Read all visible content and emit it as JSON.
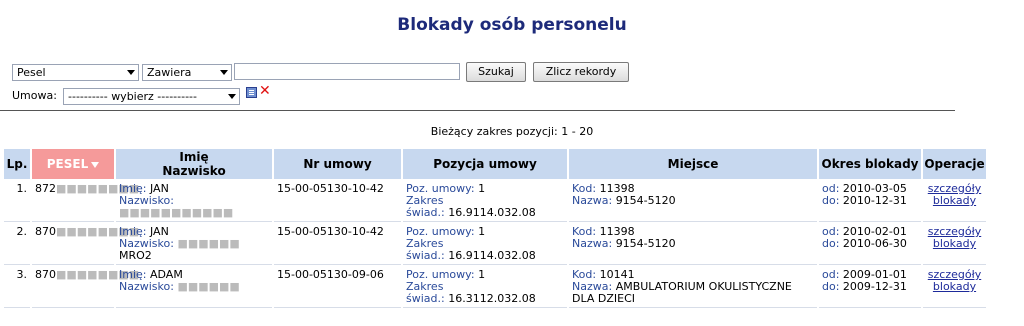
{
  "page": {
    "title": "Blokady osób personelu"
  },
  "search": {
    "field_select": "Pesel",
    "mode_select": "Zawiera",
    "query": "",
    "search_button": "Szukaj",
    "count_button": "Zlicz rekordy"
  },
  "filter": {
    "umowa_label": "Umowa:",
    "umowa_select": "---------- wybierz ----------"
  },
  "range_text": "Bieżący zakres pozycji: 1 - 20",
  "table": {
    "headers": {
      "lp": "Lp.",
      "pesel": "PESEL",
      "imie": "Imię",
      "nazwisko": "Nazwisko",
      "nr_umowy": "Nr umowy",
      "pozycja": "Pozycja umowy",
      "miejsce": "Miejsce",
      "okres": "Okres blokady",
      "operacje": "Operacje"
    },
    "field_labels": {
      "imie": "Imię:",
      "nazwisko": "Nazwisko:",
      "poz": "Poz. umowy:",
      "zakres": "Zakres",
      "swiad": "świad.:",
      "kod": "Kod:",
      "nazwa": "Nazwa:",
      "od": "od:",
      "do": "do:",
      "op1": "szczegóły",
      "op2": "blokady"
    },
    "rows": [
      {
        "lp": "1.",
        "pesel_prefix": "872",
        "pesel_masked": "■■■■■■■■",
        "imie": "JAN",
        "nazwisko_masked": "■■■■■■■■■■■",
        "nazwisko_extra": "",
        "nr_umowy": "15-00-05130-10-42",
        "poz": "1",
        "swiad": "16.9114.032.08",
        "kod": "11398",
        "nazwa": "9154-5120",
        "nazwa_extra": "",
        "od": "2010-03-05",
        "do": "2010-12-31"
      },
      {
        "lp": "2.",
        "pesel_prefix": "870",
        "pesel_masked": "■■■■■■■■",
        "imie": "JAN",
        "nazwisko_masked": "■■■■■■",
        "nazwisko_extra": "MRO2",
        "nr_umowy": "15-00-05130-10-42",
        "poz": "1",
        "swiad": "16.9114.032.08",
        "kod": "11398",
        "nazwa": "9154-5120",
        "nazwa_extra": "",
        "od": "2010-02-01",
        "do": "2010-06-30"
      },
      {
        "lp": "3.",
        "pesel_prefix": "870",
        "pesel_masked": "■■■■■■■■",
        "imie": "ADAM",
        "nazwisko_masked": "■■■■■■",
        "nazwisko_extra": "",
        "nr_umowy": "15-00-05130-09-06",
        "poz": "1",
        "swiad": "16.3112.032.08",
        "kod": "10141",
        "nazwa": "AMBULATORIUM OKULISTYCZNE",
        "nazwa_extra": "DLA DZIECI",
        "od": "2009-01-01",
        "do": "2009-12-31"
      }
    ]
  }
}
